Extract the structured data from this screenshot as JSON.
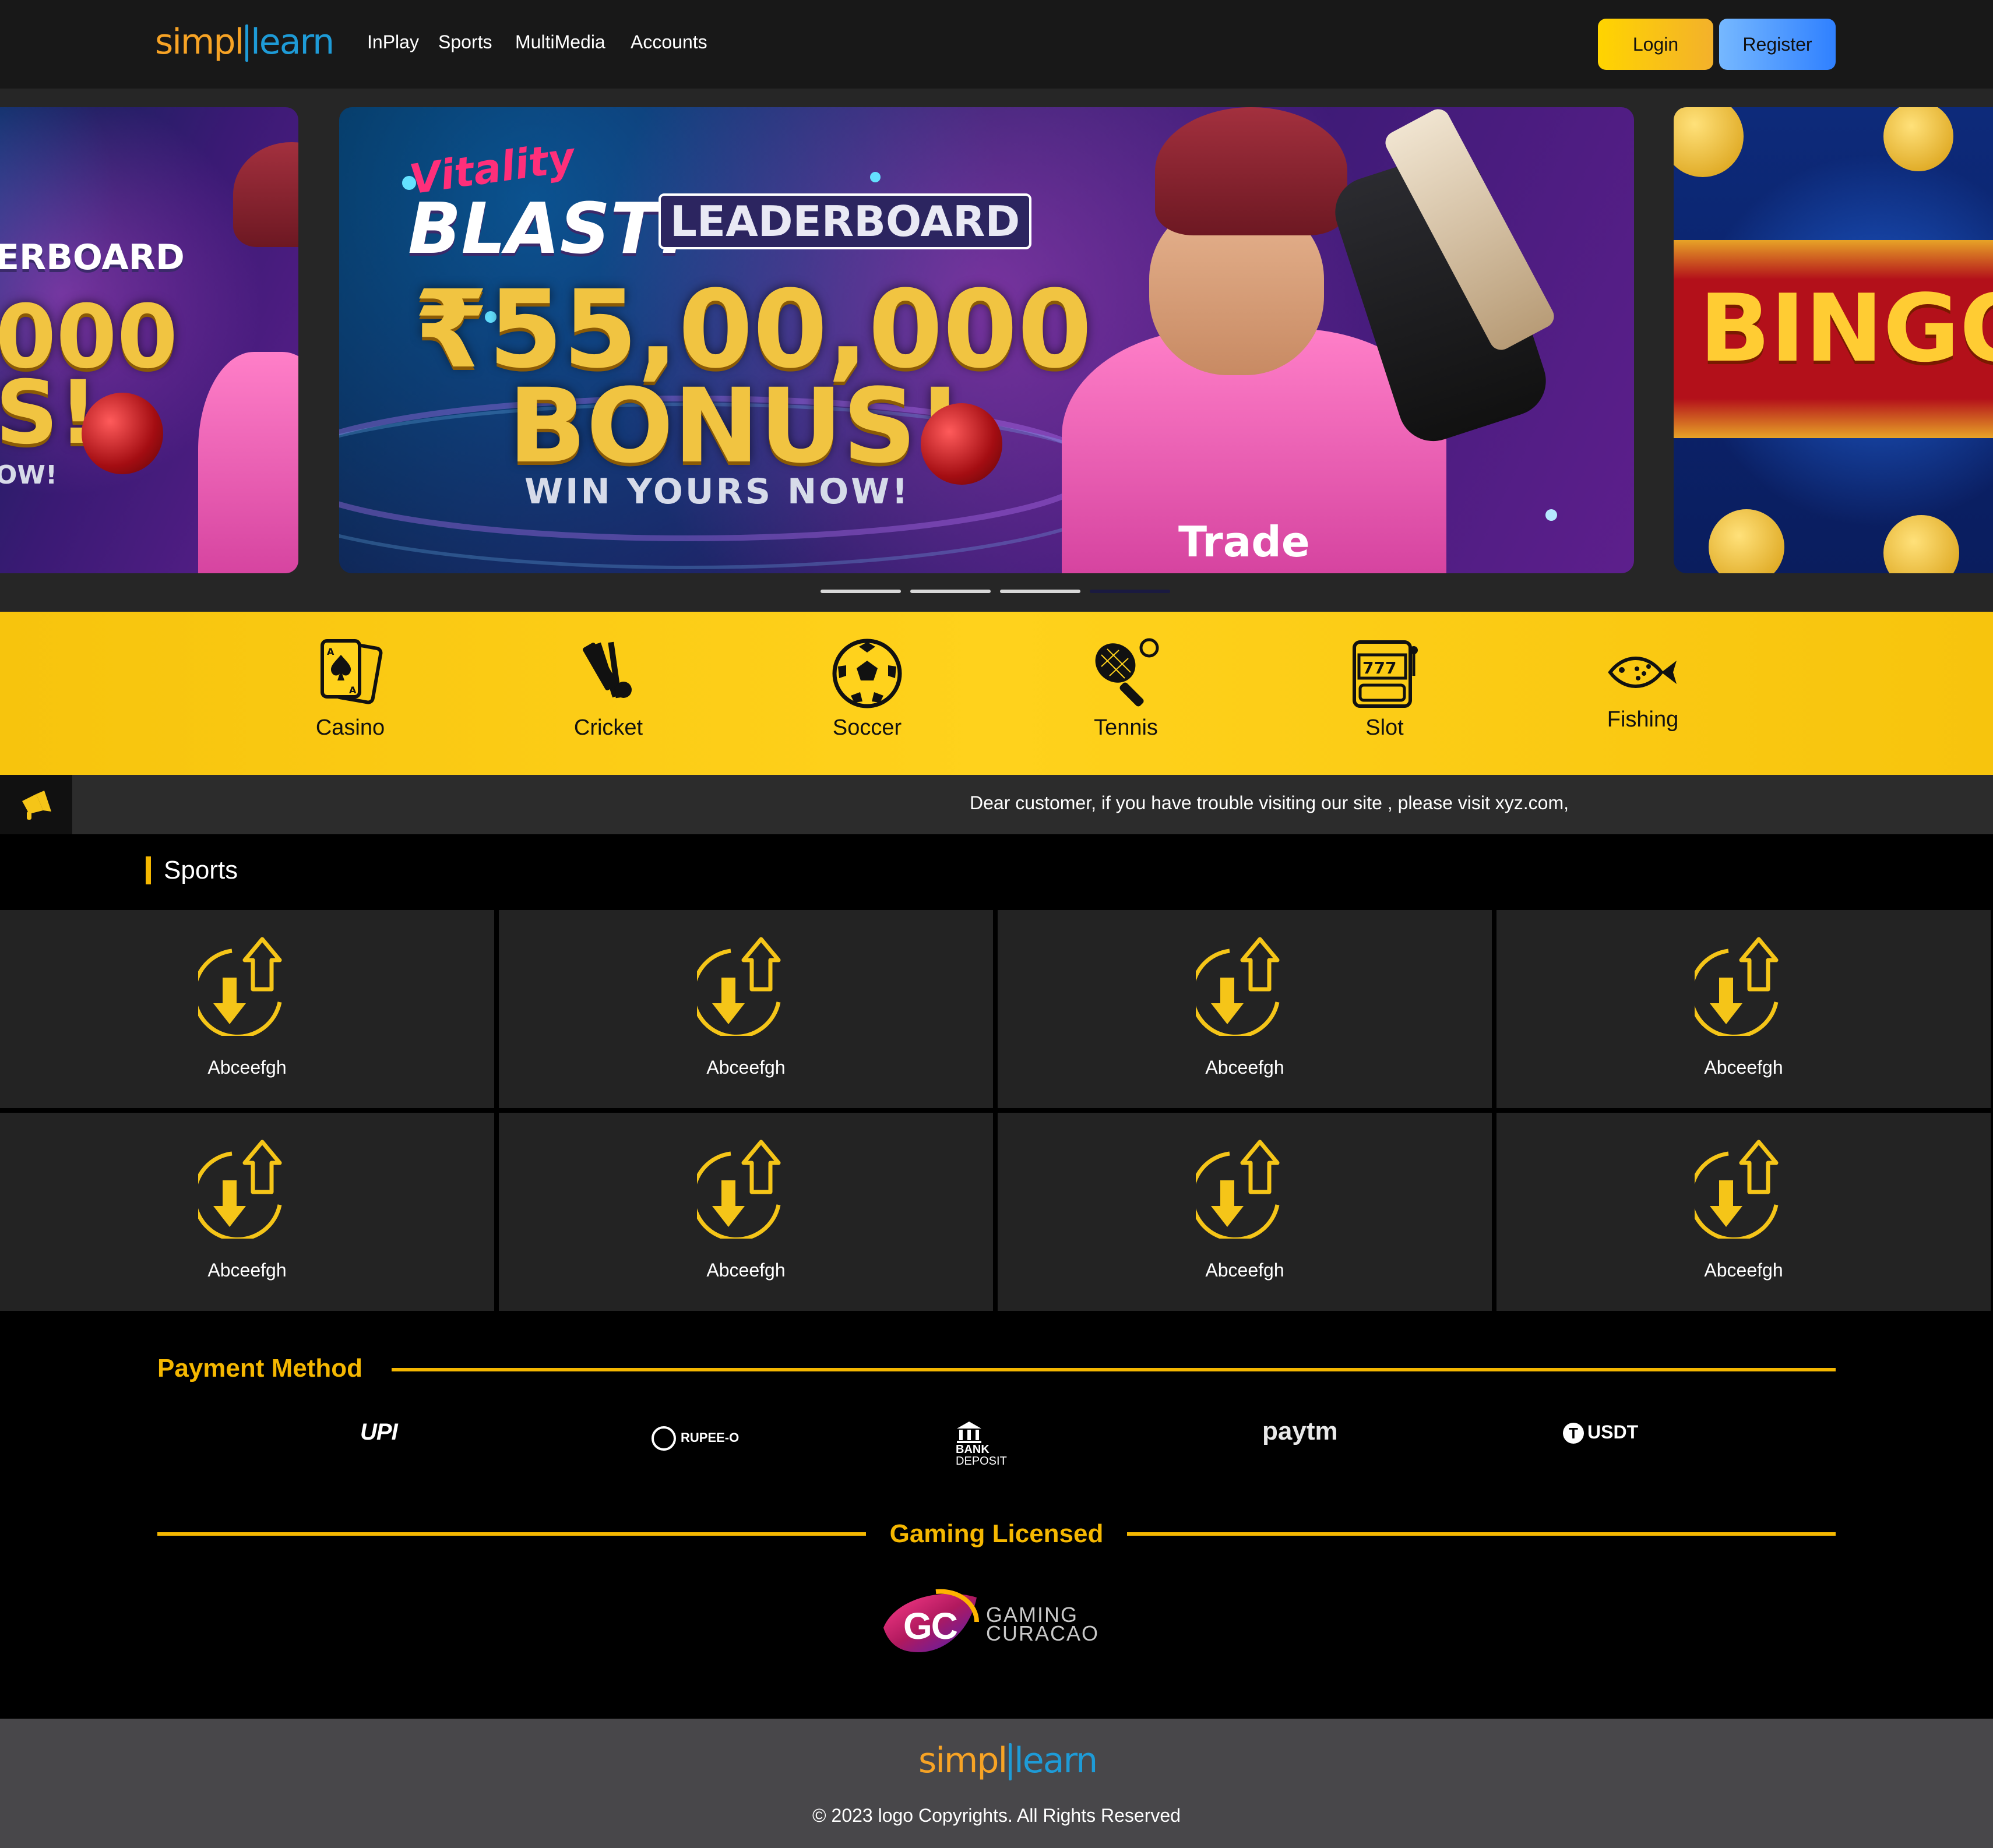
{
  "brand": {
    "part1": "simpl",
    "part2": "learn",
    "color_primary": "#f7a325",
    "color_secondary": "#1e9bd7"
  },
  "nav": {
    "items": [
      "InPlay",
      "Sports",
      "MultiMedia",
      "Accounts"
    ]
  },
  "auth": {
    "login_label": "Login",
    "register_label": "Register"
  },
  "banner": {
    "brand_line1": "Vitality",
    "brand_line2": "BLAST!",
    "leaderboard": "LEADERBOARD",
    "amount": "₹55,00,000",
    "bonus": "BONUS!",
    "cta": "WIN YOURS NOW!",
    "sponsor": "Trade",
    "prev_leaderboard": "ERBOARD",
    "prev_amount": "000",
    "prev_bonus": "S!",
    "prev_cta": "OW!",
    "bingo": "BINGO",
    "slide_count": 4,
    "active_slide": 4
  },
  "categories": [
    {
      "label": "Casino",
      "icon": "cards-icon"
    },
    {
      "label": "Cricket",
      "icon": "cricket-icon"
    },
    {
      "label": "Soccer",
      "icon": "soccer-ball-icon"
    },
    {
      "label": "Tennis",
      "icon": "tennis-icon"
    },
    {
      "label": "Slot",
      "icon": "slot-machine-icon"
    },
    {
      "label": "Fishing",
      "icon": "fish-icon"
    }
  ],
  "notice": {
    "icon": "megaphone-icon",
    "text": "Dear customer, if you have trouble visiting our site , please visit xyz.com,"
  },
  "sports": {
    "title": "Sports",
    "tiles": [
      "Abceefgh",
      "Abceefgh",
      "Abceefgh",
      "Abceefgh",
      "Abceefgh",
      "Abceefgh",
      "Abceefgh",
      "Abceefgh"
    ],
    "tile_icon": "transfer-arrows-icon",
    "accent": "#f5b700"
  },
  "payment": {
    "title": "Payment Method",
    "methods": [
      "UPI",
      "RUPEE-O",
      "BANK DEPOSIT",
      "Paytm",
      "USDT"
    ],
    "upi_text": "UPI",
    "rupee_text": "RUPEE-O",
    "bank_line1": "BANK",
    "bank_line2": "DEPOSIT",
    "paytm_text": "paytm",
    "usdt_symbol": "T",
    "usdt_text": "USDT"
  },
  "licensing": {
    "title": "Gaming Licensed",
    "badge_letters": "GC",
    "line1": "GAMING",
    "line2": "CURACAO"
  },
  "footer": {
    "copyright": "© 2023 logo Copyrights. All Rights Reserved"
  }
}
